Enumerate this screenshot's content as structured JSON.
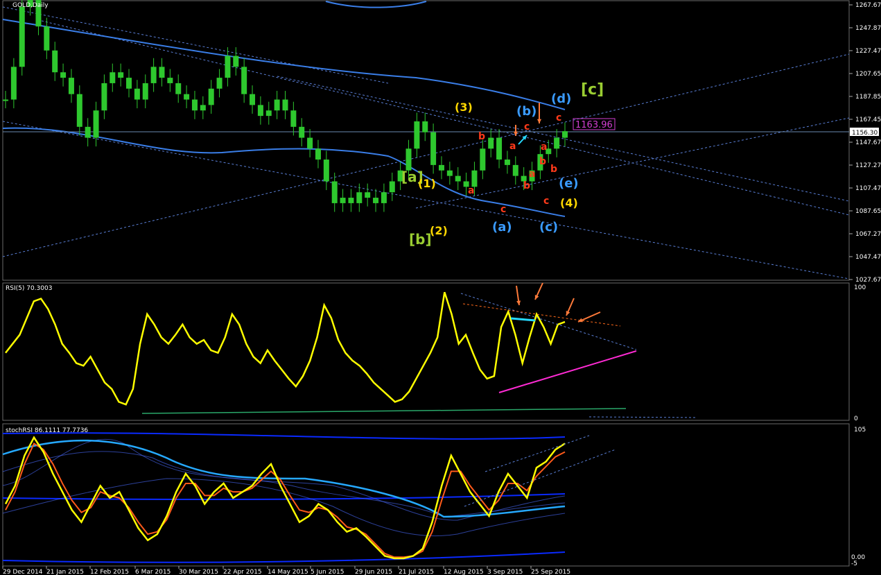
{
  "window": {
    "title": "GOLD,Daily"
  },
  "colors": {
    "background": "#000000",
    "candle": "#2ec82e",
    "ma_band": "#3a7ee8",
    "channel": "#5a7fd6",
    "price_line": "#6a8ab0",
    "rsi": "#ffff00",
    "rsi_resist": "#ff6a1a",
    "rsi_support": "#ff2bd4",
    "rsi_base": "#2aa86a",
    "cyan": "#26d9ff",
    "orange_arrow": "#ff7a3a",
    "wave_green": "#9acd32",
    "wave_yellow": "#ffd700",
    "wave_blue": "#3a9bff",
    "wave_red": "#ff3a1a",
    "price_tag": "#d43fd4",
    "stoch_k": "#ffff00",
    "stoch_d": "#ff5a1a",
    "stoch_band": "#0a2aff"
  },
  "price_panel": {
    "current_price": "1156.30",
    "tag_price": "1163.96",
    "y_ticks": [
      "1267.67",
      "1247.87",
      "1227.47",
      "1207.65",
      "1187.85",
      "1167.45",
      "1147.67",
      "1127.27",
      "1107.47",
      "1087.65",
      "1067.27",
      "1047.47",
      "1027.67"
    ]
  },
  "rsi_panel": {
    "label": "RSI(5) 70.3003",
    "y_ticks": [
      "100",
      "0"
    ]
  },
  "stoch_panel": {
    "label": "stochRSI 86.1111 77.7736",
    "y_ticks": [
      "105",
      "0.00",
      "-5"
    ]
  },
  "x_axis": {
    "labels": [
      "29 Dec 2014",
      "21 Jan 2015",
      "12 Feb 2015",
      "6 Mar 2015",
      "30 Mar 2015",
      "22 Apr 2015",
      "14 May 2015",
      "5 Jun 2015",
      "29 Jun 2015",
      "21 Jul 2015",
      "12 Aug 2015",
      "3 Sep 2015",
      "25 Sep 2015"
    ]
  },
  "wave_labels": [
    {
      "text": "[a]",
      "color": "green"
    },
    {
      "text": "[b]",
      "color": "green"
    },
    {
      "text": "[c]",
      "color": "green"
    },
    {
      "text": "(1)",
      "color": "yellow"
    },
    {
      "text": "(2)",
      "color": "yellow"
    },
    {
      "text": "(3)",
      "color": "yellow"
    },
    {
      "text": "(4)",
      "color": "yellow"
    },
    {
      "text": "(a)",
      "color": "blue"
    },
    {
      "text": "(b)",
      "color": "blue"
    },
    {
      "text": "(c)",
      "color": "blue"
    },
    {
      "text": "(d)",
      "color": "blue"
    },
    {
      "text": "(e)",
      "color": "blue"
    },
    {
      "text": "a",
      "color": "red"
    },
    {
      "text": "b",
      "color": "red"
    },
    {
      "text": "c",
      "color": "red"
    },
    {
      "text": "a",
      "color": "red"
    },
    {
      "text": "b",
      "color": "red"
    },
    {
      "text": "c",
      "color": "red"
    },
    {
      "text": "a",
      "color": "red"
    },
    {
      "text": "b",
      "color": "red"
    },
    {
      "text": "c",
      "color": "red"
    },
    {
      "text": "a",
      "color": "red"
    },
    {
      "text": "b",
      "color": "red"
    },
    {
      "text": "c",
      "color": "red"
    }
  ],
  "chart_data": [
    {
      "type": "line",
      "title": "GOLD,Daily",
      "series": [
        {
          "values": [
            1185,
            1215,
            1270,
            1290,
            1252,
            1230,
            1210,
            1205,
            1190,
            1160,
            1150,
            1175,
            1200,
            1210,
            1205,
            1195,
            1185,
            1200,
            1215,
            1205,
            1200,
            1190,
            1185,
            1175,
            1180,
            1195,
            1205,
            1225,
            1215,
            1190,
            1180,
            1170,
            1175,
            1185,
            1175,
            1160,
            1150,
            1140,
            1130,
            1110,
            1090,
            1095,
            1090,
            1100,
            1095,
            1090,
            1100,
            1110,
            1120,
            1140,
            1165,
            1155,
            1125,
            1120,
            1115,
            1110,
            1105,
            1120,
            1140,
            1150,
            1130,
            1125,
            1115,
            1110,
            1120,
            1135,
            1140,
            1150,
            1156
          ]
        }
      ]
    },
    {
      "type": "line",
      "title": "RSI(5) 70.3003",
      "ylim": [
        0,
        100
      ],
      "series": [
        {
          "values": [
            48,
            55,
            62,
            75,
            88,
            90,
            82,
            70,
            55,
            48,
            40,
            38,
            45,
            35,
            25,
            20,
            10,
            8,
            20,
            55,
            78,
            70,
            60,
            55,
            62,
            70,
            60,
            55,
            58,
            50,
            48,
            60,
            78,
            70,
            55,
            45,
            40,
            50,
            42,
            35,
            28,
            22,
            30,
            42,
            60,
            85,
            75,
            58,
            48,
            42,
            38,
            32,
            25,
            20,
            15,
            10,
            12,
            18,
            28,
            38,
            48,
            60,
            95,
            78,
            55,
            62,
            48,
            35,
            28,
            30,
            68,
            80,
            62,
            40,
            60,
            78,
            68,
            55,
            70,
            72
          ]
        }
      ]
    },
    {
      "type": "line",
      "title": "stochRSI 86.1111 77.7736",
      "ylim": [
        0,
        105
      ],
      "series": [
        {
          "values": [
            45,
            60,
            85,
            100,
            88,
            70,
            55,
            40,
            30,
            45,
            60,
            50,
            55,
            40,
            25,
            15,
            20,
            35,
            55,
            70,
            60,
            45,
            55,
            62,
            50,
            55,
            60,
            70,
            78,
            60,
            45,
            30,
            35,
            45,
            40,
            30,
            22,
            25,
            18,
            10,
            2,
            0,
            0,
            2,
            8,
            30,
            60,
            85,
            70,
            55,
            45,
            35,
            55,
            70,
            60,
            50,
            75,
            80,
            90,
            95
          ]
        },
        {
          "values": [
            40,
            55,
            78,
            95,
            90,
            78,
            62,
            48,
            38,
            42,
            55,
            52,
            50,
            42,
            30,
            20,
            22,
            32,
            50,
            62,
            62,
            52,
            52,
            58,
            55,
            55,
            58,
            65,
            72,
            65,
            52,
            40,
            38,
            42,
            40,
            34,
            26,
            24,
            20,
            12,
            4,
            1,
            1,
            2,
            6,
            22,
            48,
            72,
            72,
            60,
            50,
            40,
            48,
            62,
            62,
            56,
            68,
            76,
            84,
            88
          ]
        }
      ]
    }
  ]
}
